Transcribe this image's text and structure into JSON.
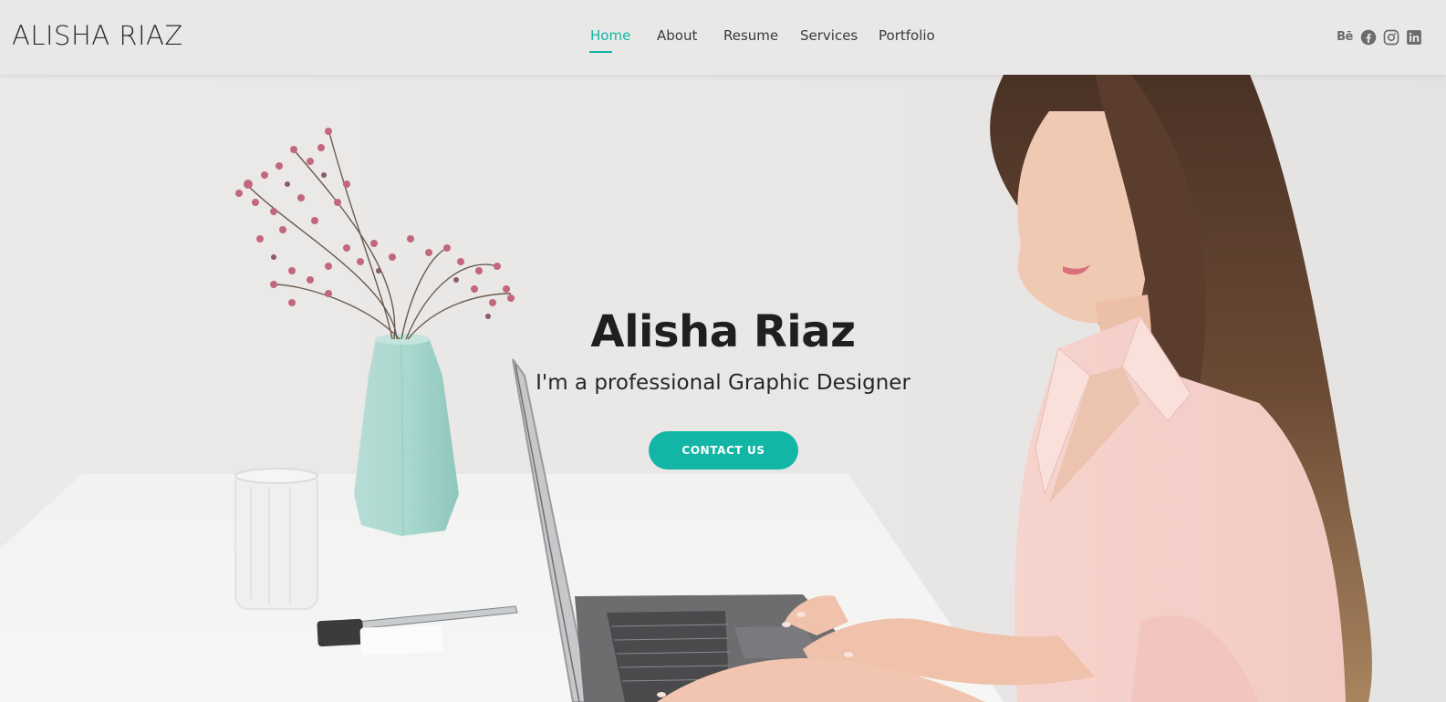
{
  "header": {
    "logo": "ALISHA RIAZ",
    "nav": [
      {
        "label": "Home",
        "active": true
      },
      {
        "label": "About",
        "active": false
      },
      {
        "label": "Resume",
        "active": false
      },
      {
        "label": "Services",
        "active": false
      },
      {
        "label": "Portfolio",
        "active": false
      }
    ],
    "social": [
      {
        "icon": "behance-icon",
        "text": "Bē"
      },
      {
        "icon": "facebook-icon"
      },
      {
        "icon": "instagram-icon"
      },
      {
        "icon": "linkedin-icon"
      }
    ]
  },
  "hero": {
    "name": "Alisha Riaz",
    "subtitle": "I'm a professional Graphic Designer",
    "button_label": "CONTACT US"
  },
  "colors": {
    "accent": "#13b6a6",
    "header_bg": "#e9e8e6",
    "hero_bg": "#ebe9e7"
  }
}
